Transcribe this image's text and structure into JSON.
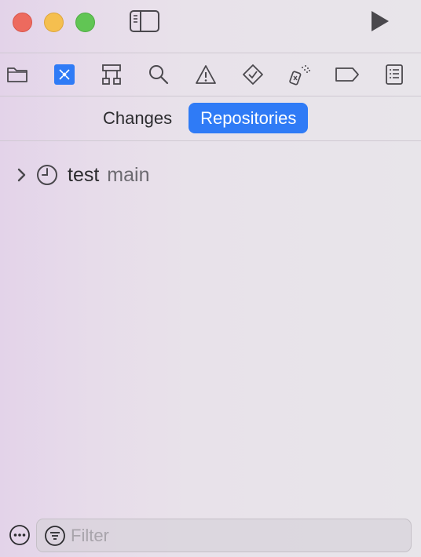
{
  "titlebar": {
    "icons": [
      "close-button",
      "minimize-button",
      "zoom-button",
      "sidebar-toggle-icon",
      "play-icon"
    ]
  },
  "navigator": {
    "tabs": [
      {
        "icon": "folder-icon",
        "selected": false
      },
      {
        "icon": "source-control-icon",
        "selected": true
      },
      {
        "icon": "hierarchy-icon",
        "selected": false
      },
      {
        "icon": "search-icon",
        "selected": false
      },
      {
        "icon": "warning-icon",
        "selected": false
      },
      {
        "icon": "test-diamond-icon",
        "selected": false
      },
      {
        "icon": "debug-spray-icon",
        "selected": false
      },
      {
        "icon": "breakpoint-tag-icon",
        "selected": false
      },
      {
        "icon": "report-list-icon",
        "selected": false
      }
    ]
  },
  "segmented": {
    "changes_label": "Changes",
    "repositories_label": "Repositories",
    "selected": "Repositories"
  },
  "repo": {
    "name": "test",
    "branch": "main"
  },
  "filter": {
    "placeholder": "Filter",
    "value": ""
  },
  "colors": {
    "accent": "#2f7bf6",
    "close": "#ed6a5e",
    "minimize": "#f5bf4f",
    "zoom": "#61c554"
  }
}
